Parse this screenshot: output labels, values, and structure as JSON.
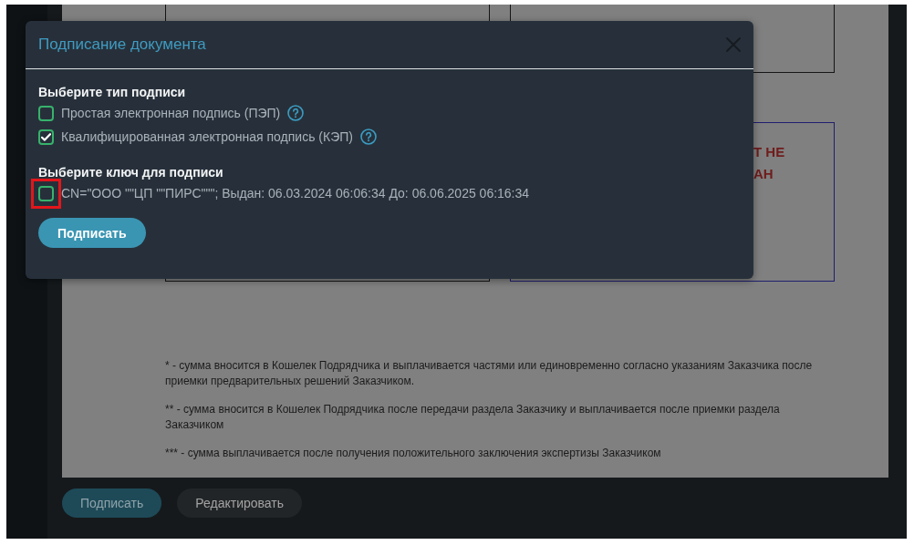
{
  "dialog": {
    "title": "Подписание документа",
    "sections": [
      {
        "heading": "Выберите тип подписи",
        "options": [
          {
            "label": "Простая электронная подпись (ПЭП)",
            "checked": false,
            "help": true
          },
          {
            "label": "Квалифицированная электронная подпись (КЭП)",
            "checked": true,
            "help": true
          }
        ]
      },
      {
        "heading": "Выберите ключ для подписи",
        "options": [
          {
            "label": "CN=\"ООО \"\"ЦП \"\"ПИРС\"\"\"; Выдан: 06.03.2024 06:06:34 До: 06.06.2025 06:16:34",
            "checked": false,
            "highlighted": true
          }
        ]
      }
    ],
    "submit": "Подписать"
  },
  "document": {
    "status_lines": [
      "Т НЕ",
      "АН"
    ],
    "footnotes": [
      "* - сумма вносится в Кошелек Подрядчика и выплачивается частями или единовременно согласно указаниям Заказчика после приемки предварительных решений Заказчиком.",
      "** - сумма вносится в Кошелек Подрядчика после передачи раздела Заказчику и выплачивается после приемки раздела Заказчиком",
      "*** - сумма выплачивается после получения положительного заключения экспертизы Заказчиком"
    ]
  },
  "actions": [
    {
      "label": "Подписать",
      "kind": "primary"
    },
    {
      "label": "Редактировать",
      "kind": "secondary"
    }
  ]
}
